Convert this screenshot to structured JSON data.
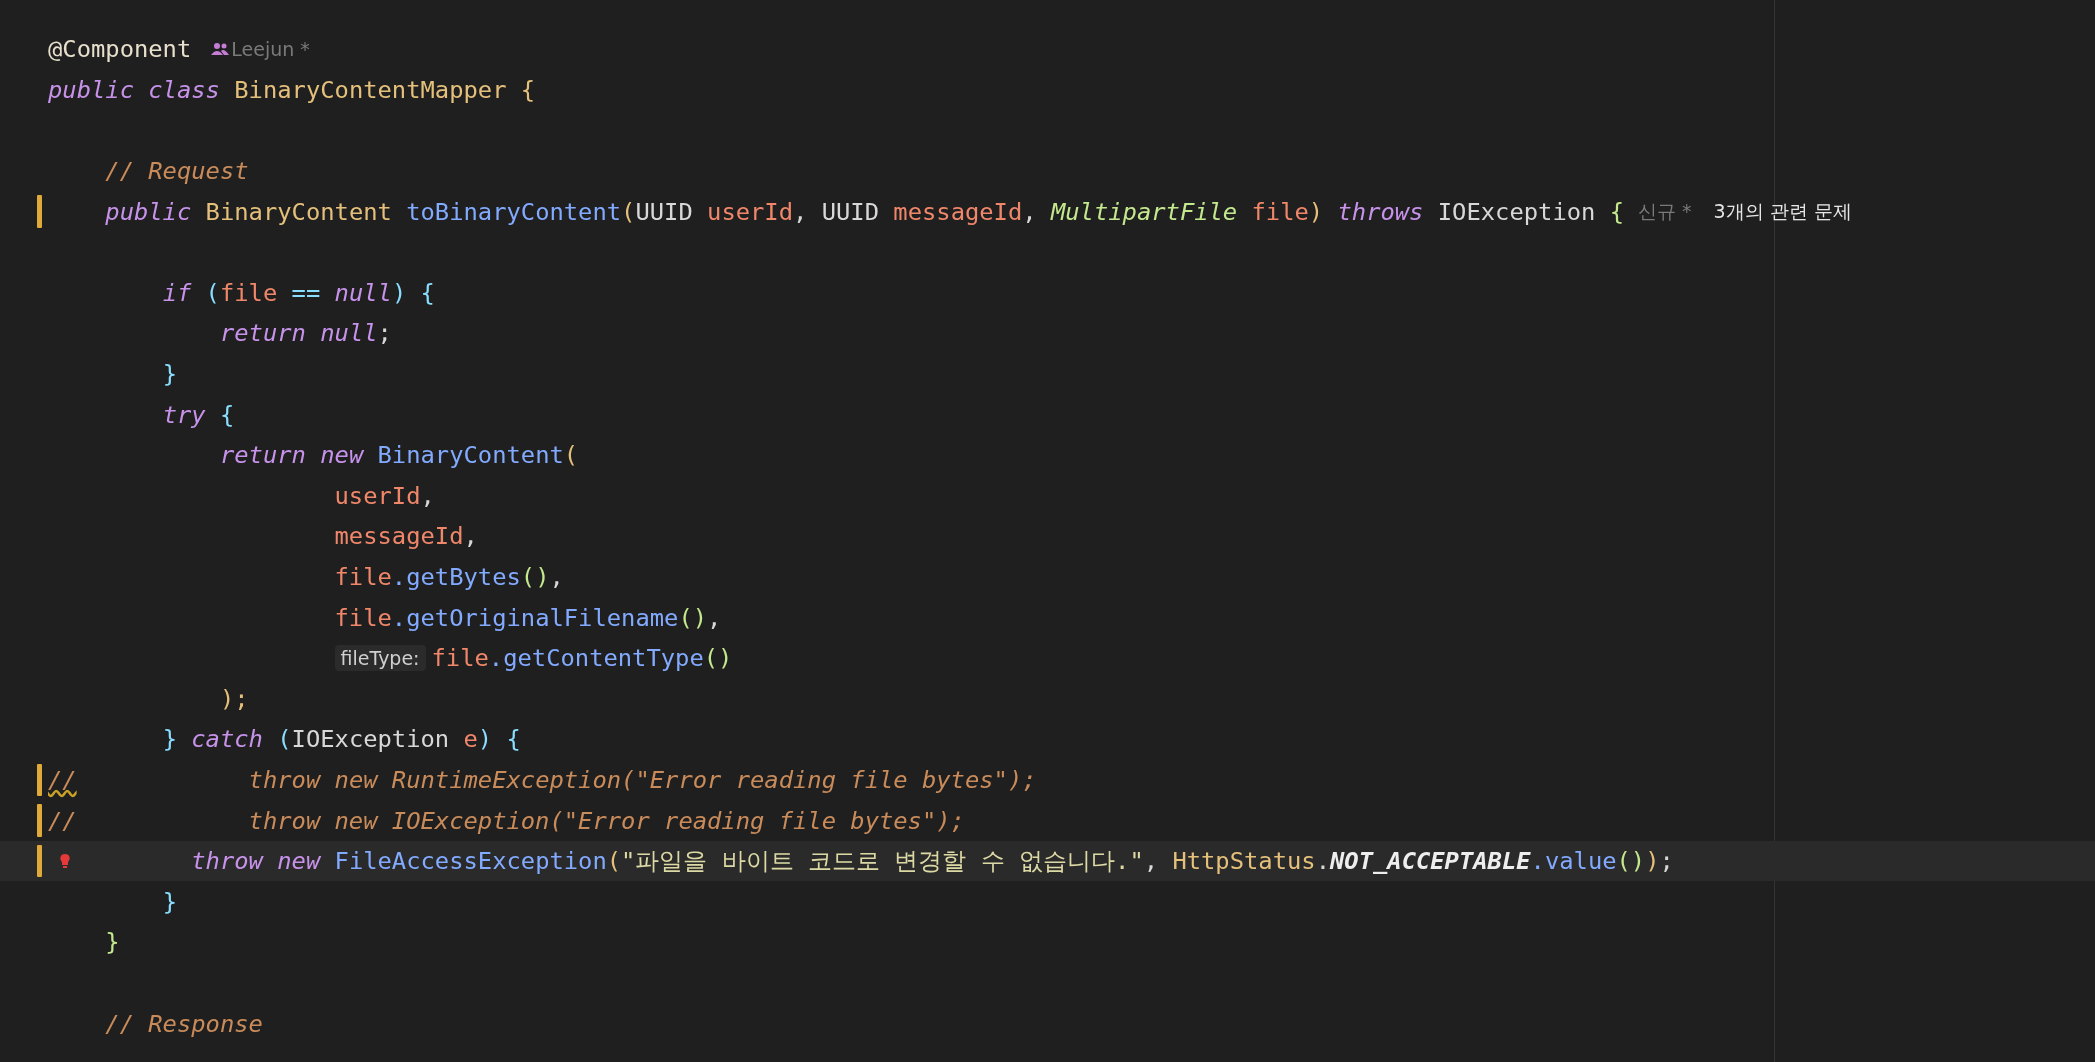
{
  "editor": {
    "lines": [
      {
        "tokens": [
          {
            "t": "@Component",
            "kind": "annotation"
          },
          {
            "t": "Leejun *",
            "kind": "author"
          }
        ]
      },
      {
        "tokens": [
          {
            "t": "public class ",
            "kind": "kw"
          },
          {
            "t": "BinaryContentMapper ",
            "kind": "type"
          },
          {
            "t": "{",
            "kind": "b1"
          }
        ]
      },
      {
        "gap_before": true,
        "tokens": [
          {
            "t": "    // Request",
            "kind": "comment"
          }
        ]
      },
      {
        "modified": true,
        "tokens": [
          {
            "t": "    public ",
            "kind": "kw"
          },
          {
            "t": "BinaryContent ",
            "kind": "type"
          },
          {
            "t": "toBinaryContent",
            "kind": "fn"
          },
          {
            "t": "(",
            "kind": "b1"
          },
          {
            "t": "UUID ",
            "kind": "plain"
          },
          {
            "t": "userId",
            "kind": "param"
          },
          {
            "t": ", ",
            "kind": "punc"
          },
          {
            "t": "UUID ",
            "kind": "plain"
          },
          {
            "t": "messageId",
            "kind": "param"
          },
          {
            "t": ", ",
            "kind": "punc"
          },
          {
            "t": "MultipartFile ",
            "kind": "iface"
          },
          {
            "t": "file",
            "kind": "param"
          },
          {
            "t": ") ",
            "kind": "b1"
          },
          {
            "t": "throws ",
            "kind": "kw"
          },
          {
            "t": "IOException ",
            "kind": "plain"
          },
          {
            "t": "{",
            "kind": "b2"
          },
          {
            "t": "신규 *",
            "kind": "hint"
          },
          {
            "t": "3개의 관련 문제",
            "kind": "problem"
          }
        ]
      },
      {
        "gap_before": true,
        "tokens": [
          {
            "t": "        if ",
            "kind": "kw"
          },
          {
            "t": "(",
            "kind": "b3"
          },
          {
            "t": "file ",
            "kind": "param"
          },
          {
            "t": "== ",
            "kind": "op"
          },
          {
            "t": "null",
            "kind": "kw"
          },
          {
            "t": ") ",
            "kind": "b3"
          },
          {
            "t": "{",
            "kind": "b3"
          }
        ]
      },
      {
        "tokens": [
          {
            "t": "            return null",
            "kind": "kw"
          },
          {
            "t": ";",
            "kind": "punc"
          }
        ]
      },
      {
        "tokens": [
          {
            "t": "        }",
            "kind": "b3"
          }
        ]
      },
      {
        "tokens": [
          {
            "t": "        try ",
            "kind": "kw"
          },
          {
            "t": "{",
            "kind": "b3"
          }
        ]
      },
      {
        "tokens": [
          {
            "t": "            return new ",
            "kind": "kw"
          },
          {
            "t": "BinaryContent",
            "kind": "fn"
          },
          {
            "t": "(",
            "kind": "b1"
          }
        ]
      },
      {
        "tokens": [
          {
            "t": "                    userId",
            "kind": "param"
          },
          {
            "t": ",",
            "kind": "punc"
          }
        ]
      },
      {
        "tokens": [
          {
            "t": "                    messageId",
            "kind": "param"
          },
          {
            "t": ",",
            "kind": "punc"
          }
        ]
      },
      {
        "tokens": [
          {
            "t": "                    file",
            "kind": "param"
          },
          {
            "t": ".getBytes",
            "kind": "fn"
          },
          {
            "t": "()",
            "kind": "b2"
          },
          {
            "t": ",",
            "kind": "punc"
          }
        ]
      },
      {
        "tokens": [
          {
            "t": "                    file",
            "kind": "param"
          },
          {
            "t": ".getOriginalFilename",
            "kind": "fn"
          },
          {
            "t": "()",
            "kind": "b2"
          },
          {
            "t": ",",
            "kind": "punc"
          }
        ]
      },
      {
        "tokens": [
          {
            "t": "                    fileType:",
            "kind": "inlay"
          },
          {
            "t": "file",
            "kind": "param"
          },
          {
            "t": ".getContentType",
            "kind": "fn"
          },
          {
            "t": "()",
            "kind": "b2"
          }
        ]
      },
      {
        "tokens": [
          {
            "t": "            );",
            "kind": "b1"
          }
        ]
      },
      {
        "tokens": [
          {
            "t": "        } ",
            "kind": "b3"
          },
          {
            "t": "catch ",
            "kind": "kw"
          },
          {
            "t": "(",
            "kind": "b3"
          },
          {
            "t": "IOException ",
            "kind": "plain"
          },
          {
            "t": "e",
            "kind": "param"
          },
          {
            "t": ") ",
            "kind": "b3"
          },
          {
            "t": "{",
            "kind": "b3"
          }
        ]
      },
      {
        "modified": true,
        "tokens": [
          {
            "t": "//",
            "kind": "comment",
            "warn": true
          },
          {
            "t": "            throw new RuntimeException(\"Error reading file bytes\");",
            "kind": "comment"
          }
        ]
      },
      {
        "modified": true,
        "tokens": [
          {
            "t": "//            throw new IOException(\"Error reading file bytes\");",
            "kind": "comment"
          }
        ]
      },
      {
        "modified": true,
        "current": true,
        "bulb": true,
        "tokens": [
          {
            "t": "          throw new ",
            "kind": "kw"
          },
          {
            "t": "FileAccessException",
            "kind": "fn"
          },
          {
            "t": "(",
            "kind": "b1"
          },
          {
            "t": "\"파일을 바이트 코드로 변경할 수 없습니다.\"",
            "kind": "str"
          },
          {
            "t": ", ",
            "kind": "punc"
          },
          {
            "t": "HttpStatus",
            "kind": "type"
          },
          {
            "t": ".",
            "kind": "punc"
          },
          {
            "t": "NOT_ACCEPTABLE",
            "kind": "const"
          },
          {
            "t": ".value",
            "kind": "fn"
          },
          {
            "t": "()",
            "kind": "b2"
          },
          {
            "t": ")",
            "kind": "b1"
          },
          {
            "t": ";",
            "kind": "punc"
          }
        ]
      },
      {
        "tokens": [
          {
            "t": "        }",
            "kind": "b3"
          }
        ]
      },
      {
        "tokens": [
          {
            "t": "    }",
            "kind": "b2"
          }
        ]
      },
      {
        "gap_before": true,
        "tokens": [
          {
            "t": "    // Response",
            "kind": "comment"
          }
        ]
      }
    ]
  }
}
